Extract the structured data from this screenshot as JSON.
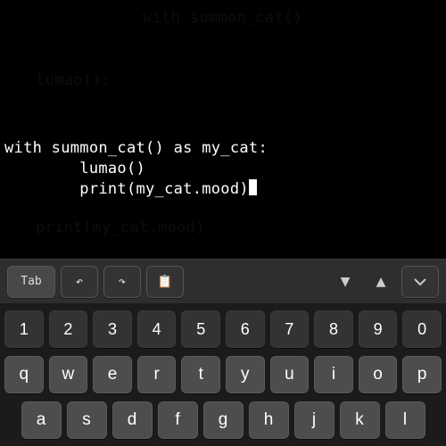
{
  "editor": {
    "ghost_line_1": "with summon_cat()",
    "ghost_line_2": "lumao():",
    "code": {
      "l1": "with summon_cat() as my_cat:",
      "l2": "        lumao()",
      "l3": "        print(my_cat.mood)"
    },
    "ghost_below": "print(my_cat.mood)"
  },
  "toolbar": {
    "tab_label": "Tab",
    "undo_label": "↶",
    "redo_label": "↷",
    "paste_label": "📋",
    "down_label": "▼",
    "up_label": "▲"
  },
  "keyboard": {
    "row_num": [
      "1",
      "2",
      "3",
      "4",
      "5",
      "6",
      "7",
      "8",
      "9",
      "0"
    ],
    "row_top": [
      "q",
      "w",
      "e",
      "r",
      "t",
      "y",
      "u",
      "i",
      "o",
      "p"
    ],
    "row_mid": [
      "a",
      "s",
      "d",
      "f",
      "g",
      "h",
      "j",
      "k",
      "l"
    ]
  }
}
